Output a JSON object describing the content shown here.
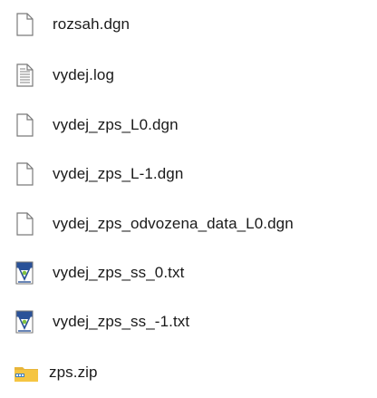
{
  "files": [
    {
      "name": "rozsah.dgn",
      "icon": "blank-document-icon"
    },
    {
      "name": "vydej.log",
      "icon": "text-document-icon"
    },
    {
      "name": "vydej_zps_L0.dgn",
      "icon": "blank-document-icon"
    },
    {
      "name": "vydej_zps_L-1.dgn",
      "icon": "blank-document-icon"
    },
    {
      "name": "vydej_zps_odvozena_data_L0.dgn",
      "icon": "blank-document-icon"
    },
    {
      "name": "vydej_zps_ss_0.txt",
      "icon": "notepad-plus-plus-document-icon"
    },
    {
      "name": "vydej_zps_ss_-1.txt",
      "icon": "notepad-plus-plus-document-icon"
    },
    {
      "name": "zps.zip",
      "icon": "zip-folder-icon"
    }
  ],
  "colors": {
    "text": "#1a1a1a",
    "document_outline": "#7a7a7a",
    "document_lines": "#8c8c8c",
    "notepad_blue": "#2a5298",
    "notepad_accent": "#7fc241",
    "zip_folder": "#f5c542",
    "zip_zipper": "#3f7fc0"
  }
}
